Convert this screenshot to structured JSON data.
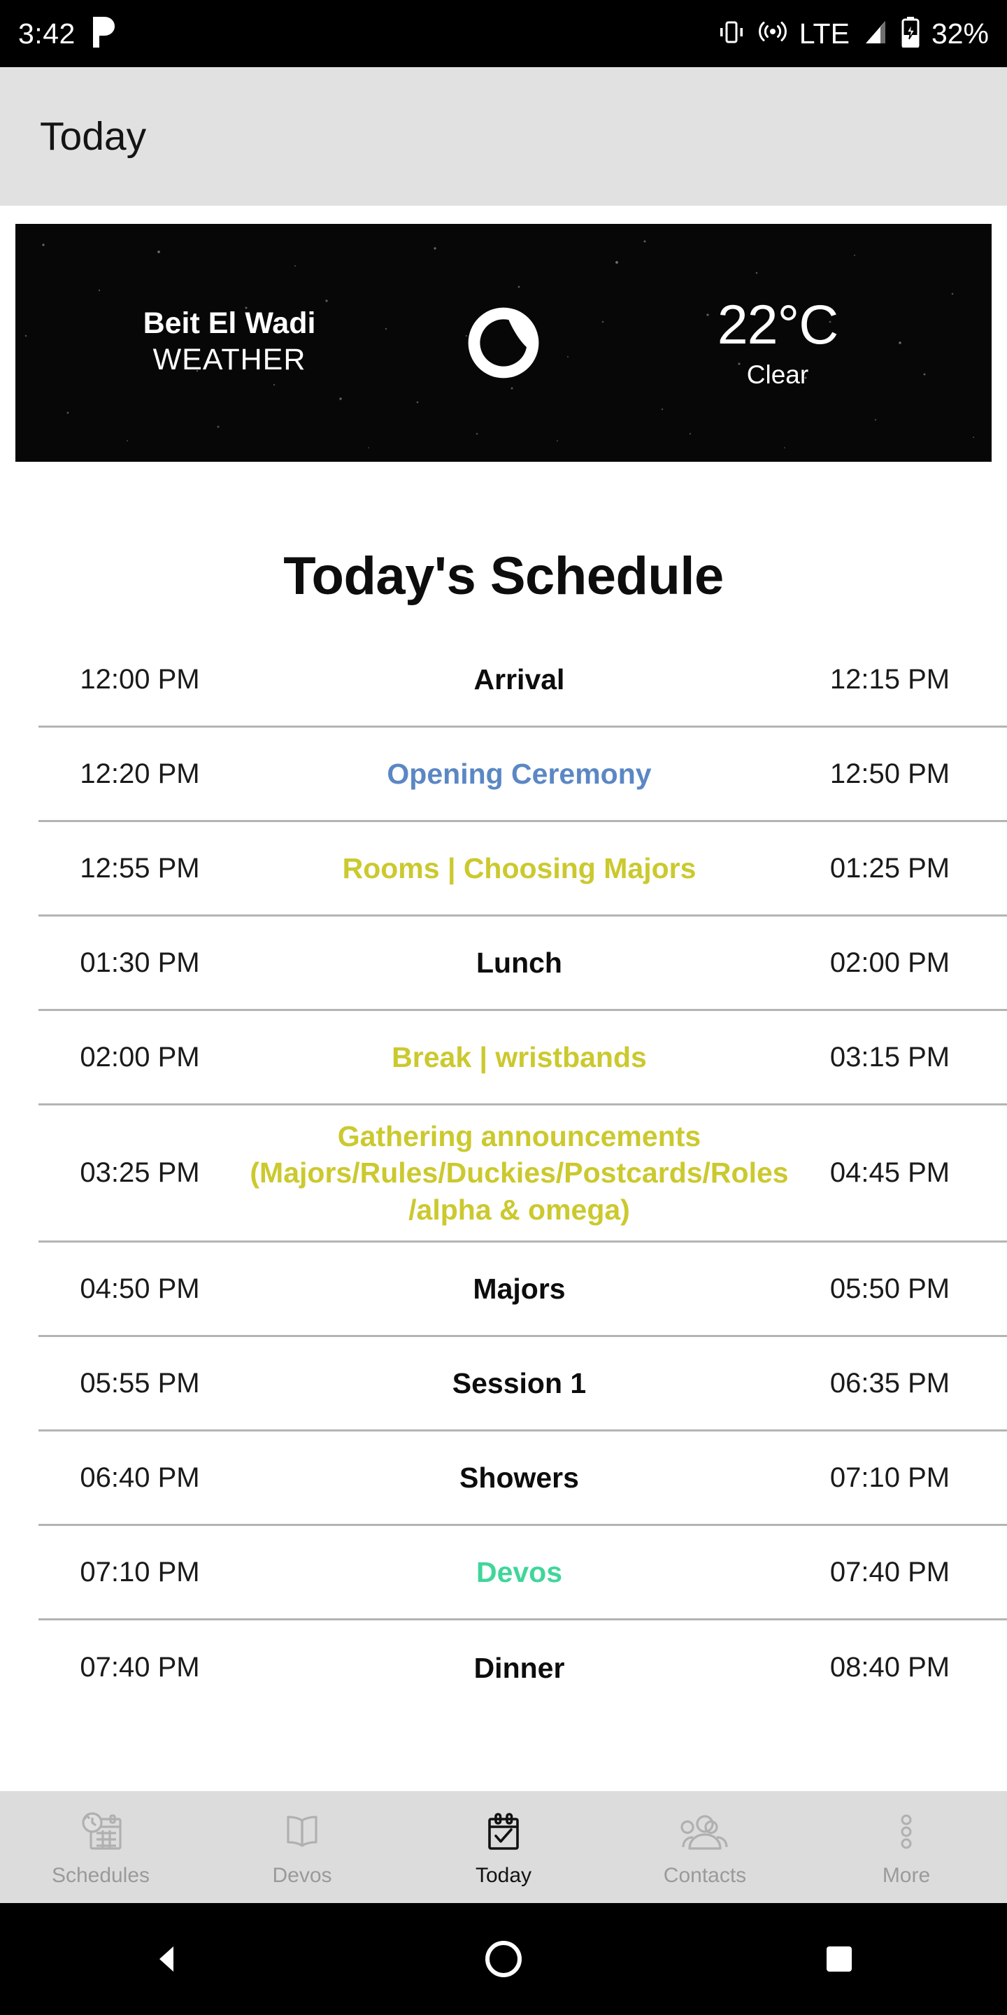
{
  "status_bar": {
    "time": "3:42",
    "app_icon": "pandora-icon",
    "icons": [
      "vibrate-icon",
      "hotspot-icon",
      "signal-icon",
      "battery-charging-icon"
    ],
    "network": "LTE",
    "battery": "32%"
  },
  "header": {
    "title": "Today"
  },
  "weather": {
    "location": "Beit El Wadi",
    "label": "WEATHER",
    "icon": "crescent-moon-icon",
    "temperature": "22°C",
    "condition": "Clear"
  },
  "schedule": {
    "title": "Today's Schedule",
    "rows": [
      {
        "start": "12:00 PM",
        "name": "Arrival",
        "end": "12:15 PM",
        "color": "#0d0d0d"
      },
      {
        "start": "12:20 PM",
        "name": "Opening Ceremony",
        "end": "12:50 PM",
        "color": "#5b87c4"
      },
      {
        "start": "12:55 PM",
        "name": "Rooms | Choosing Majors",
        "end": "01:25 PM",
        "color": "#cbc92e"
      },
      {
        "start": "01:30 PM",
        "name": "Lunch",
        "end": "02:00 PM",
        "color": "#0d0d0d"
      },
      {
        "start": "02:00 PM",
        "name": "Break | wristbands",
        "end": "03:15 PM",
        "color": "#cbc92e"
      },
      {
        "start": "03:25 PM",
        "name": "Gathering announcements (Majors/Rules/Duckies/Postcards/Roles/alpha & omega)",
        "end": "04:45 PM",
        "color": "#cbc92e"
      },
      {
        "start": "04:50 PM",
        "name": "Majors",
        "end": "05:50 PM",
        "color": "#0d0d0d"
      },
      {
        "start": "05:55 PM",
        "name": "Session 1",
        "end": "06:35 PM",
        "color": "#0d0d0d"
      },
      {
        "start": "06:40 PM",
        "name": "Showers",
        "end": "07:10 PM",
        "color": "#0d0d0d"
      },
      {
        "start": "07:10 PM",
        "name": "Devos",
        "end": "07:40 PM",
        "color": "#3fd69a"
      },
      {
        "start": "07:40 PM",
        "name": "Dinner",
        "end": "08:40 PM",
        "color": "#0d0d0d"
      }
    ]
  },
  "tabbar": {
    "tabs": [
      {
        "label": "Schedules",
        "icon": "schedules-calendar-clock-icon",
        "active": false
      },
      {
        "label": "Devos",
        "icon": "open-book-icon",
        "active": false
      },
      {
        "label": "Today",
        "icon": "calendar-check-icon",
        "active": true
      },
      {
        "label": "Contacts",
        "icon": "people-group-icon",
        "active": false
      },
      {
        "label": "More",
        "icon": "more-vertical-dots-icon",
        "active": false
      }
    ]
  },
  "navbar": {
    "buttons": [
      {
        "name": "back",
        "icon": "triangle-back-icon"
      },
      {
        "name": "home",
        "icon": "circle-home-icon"
      },
      {
        "name": "recents",
        "icon": "square-recents-icon"
      }
    ]
  },
  "colors": {
    "accent_blue": "#5b87c4",
    "accent_yellow": "#cbc92e",
    "accent_green": "#3fd69a",
    "header_bg": "#e1e1e1",
    "tabbar_bg": "#dcdcdc",
    "divider": "#b4b4b4"
  }
}
